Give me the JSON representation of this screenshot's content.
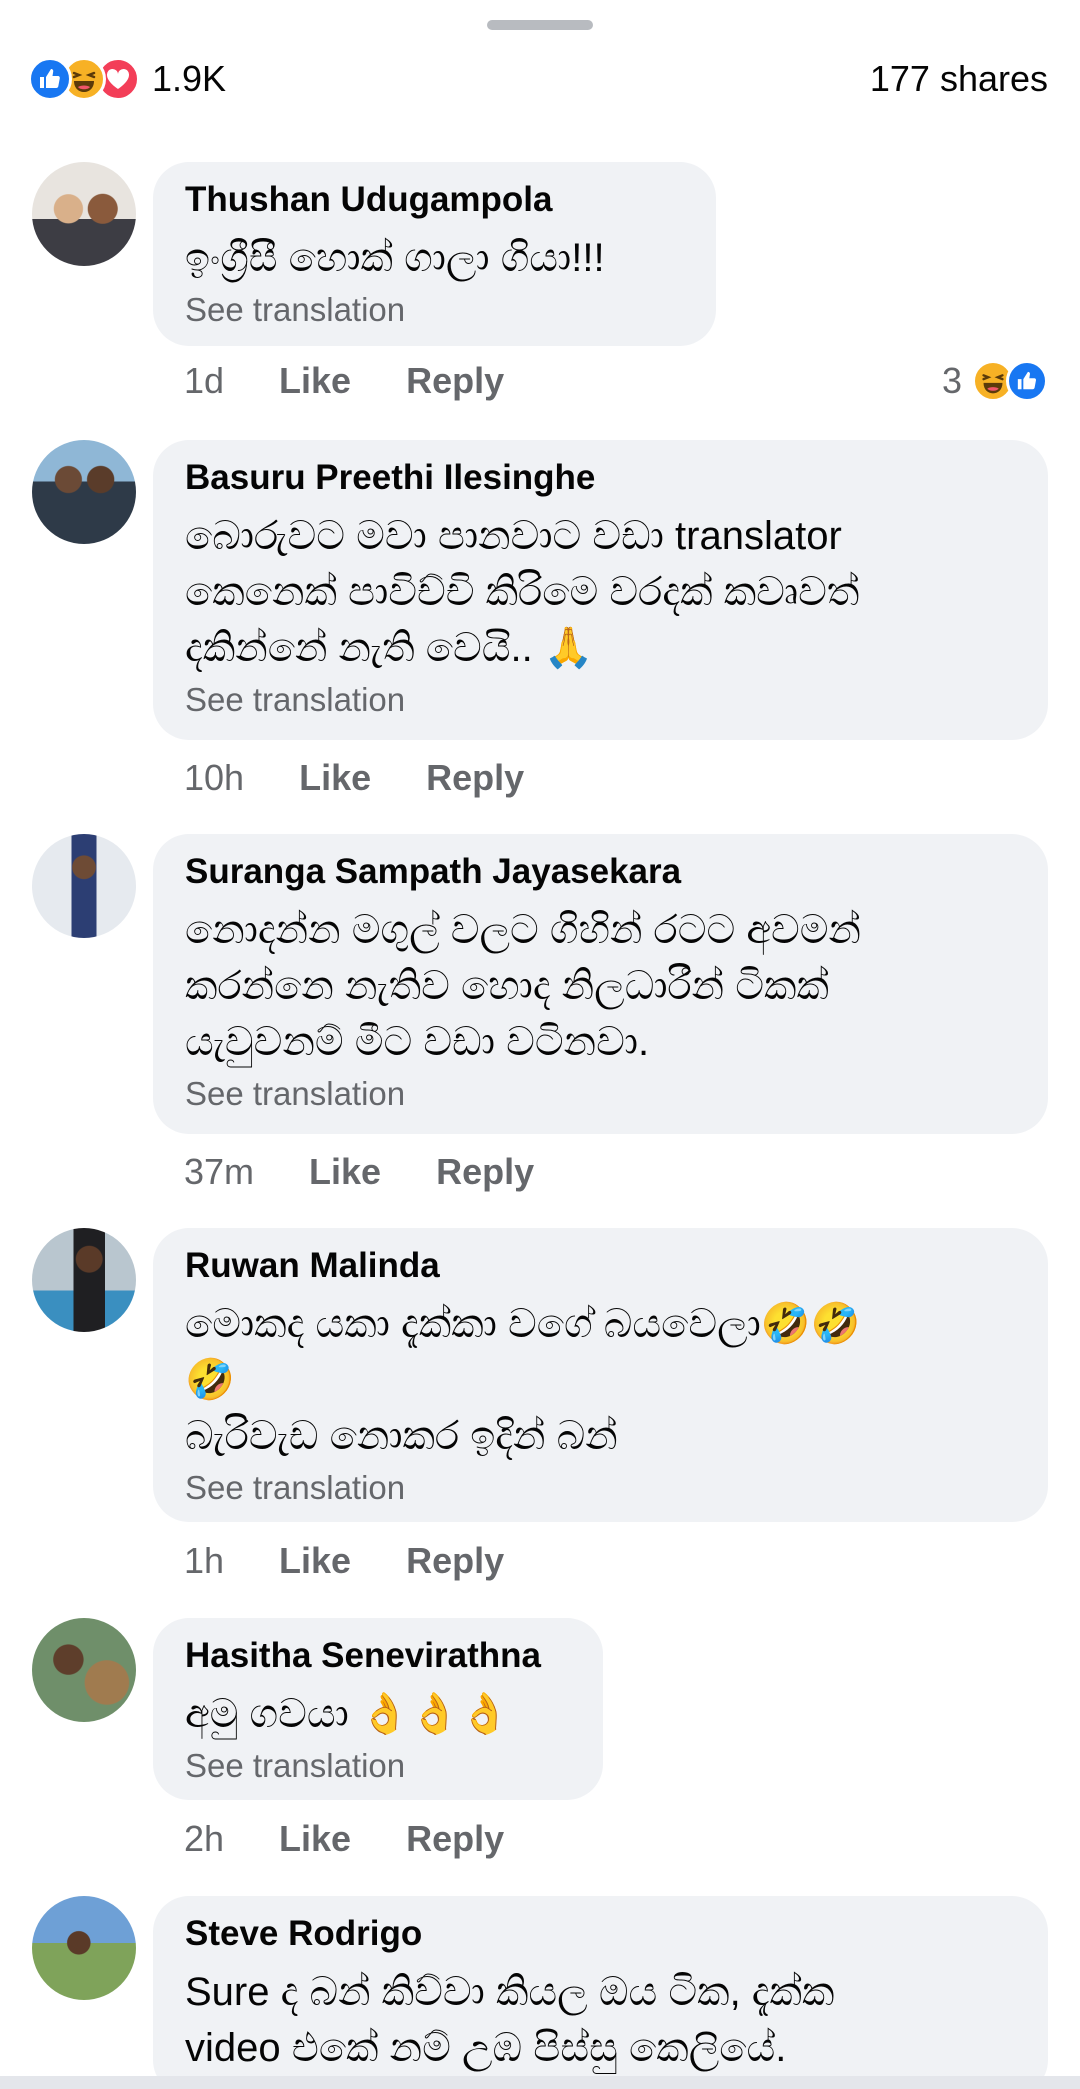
{
  "header": {
    "reaction_icons": [
      "like-icon",
      "haha-icon",
      "love-icon"
    ],
    "reaction_count": "1.9K",
    "shares": "177 shares"
  },
  "colors": {
    "like": "#1877f2",
    "haha": "#f7b125",
    "love": "#f33e58",
    "bubble": "#f0f2f5",
    "meta_text": "#65676b"
  },
  "comments": [
    {
      "name": "Thushan Udugampola",
      "lines": [
        "ඉංග්‍රීසී හොක් ගාලා ගියා!!!"
      ],
      "see_translation": "See translation",
      "time": "1d",
      "like": "Like",
      "reply": "Reply",
      "reaction_count": "3",
      "reaction_icons": [
        "haha-icon",
        "like-icon"
      ]
    },
    {
      "name": "Basuru Preethi Ilesinghe",
      "lines": [
        "බොරුවට මවා පානවාට වඩා translator",
        "කෙනෙක් පාවිච්චි කිරිමෙ වරදක් කවෘවත්",
        "දකින්නේ නැති වෙයි.. 🙏"
      ],
      "see_translation": "See translation",
      "time": "10h",
      "like": "Like",
      "reply": "Reply"
    },
    {
      "name": "Suranga Sampath Jayasekara",
      "lines": [
        "නොදන්න මගුල් වලට ගිහින් රටට අවමන්",
        "කරන්නෙ නැතිව හොද නිලධාරීන් ටිකක්",
        "යැවුවනම් මීට වඩා වටිනවා."
      ],
      "see_translation": "See translation",
      "time": "37m",
      "like": "Like",
      "reply": "Reply"
    },
    {
      "name": "Ruwan Malinda",
      "lines": [
        "මොකද යකා දැක්කා වගේ බයවෙලා🤣🤣",
        "🤣",
        "බැරිවැඩ නොකර ඉදින් බන්"
      ],
      "see_translation": "See translation",
      "time": "1h",
      "like": "Like",
      "reply": "Reply"
    },
    {
      "name": "Hasitha Senevirathna",
      "lines": [
        "අමු ගවයා 👌👌👌"
      ],
      "see_translation": "See translation",
      "time": "2h",
      "like": "Like",
      "reply": "Reply"
    },
    {
      "name": "Steve Rodrigo",
      "lines": [
        "Sure ද බන් කිව්වා කියල ඔය ටික, දැක්ක",
        "video එකේ නම් උඹ පිස්සු කෙලියේ."
      ]
    }
  ]
}
